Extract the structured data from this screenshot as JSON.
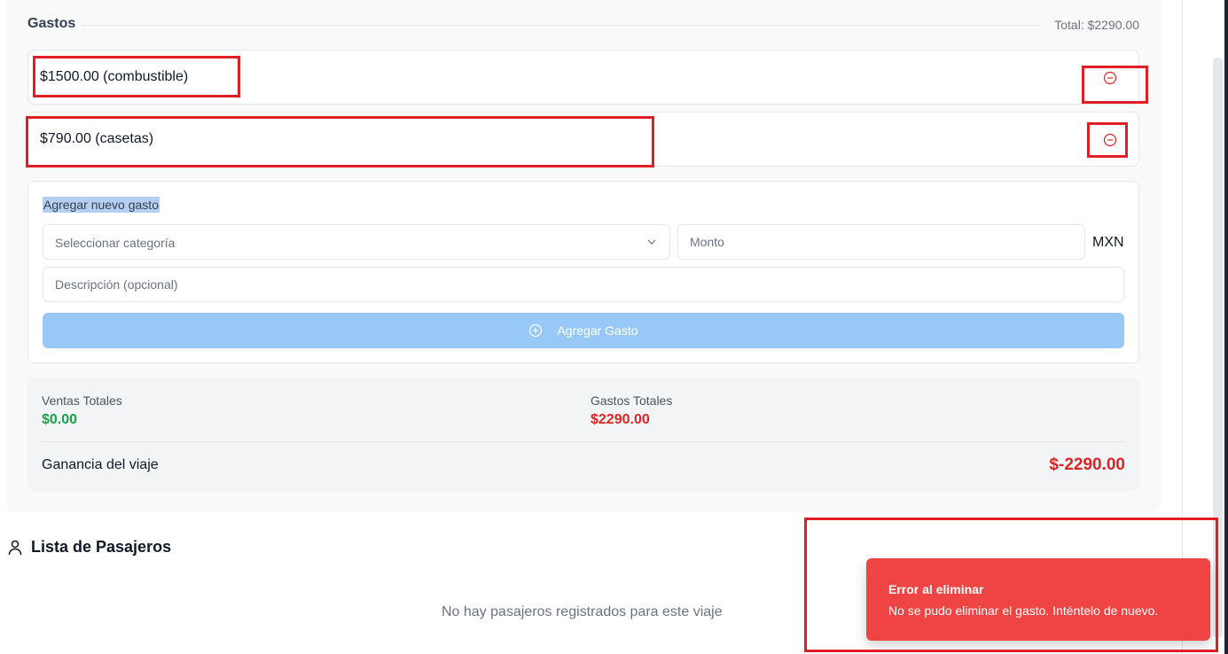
{
  "expenses": {
    "title": "Gastos",
    "total": "Total: $2290.00",
    "items": [
      {
        "label": "$1500.00 (combustible)",
        "remove_icon": "minus-circle-icon"
      },
      {
        "label": "$790.00 (casetas)",
        "remove_icon": "minus-circle-icon"
      }
    ]
  },
  "add_expense": {
    "title": "Agregar nuevo gasto",
    "category_placeholder": "Seleccionar categoría",
    "amount_placeholder": "Monto",
    "currency": "MXN",
    "description_placeholder": "Descripción (opcional)",
    "button_label": "Agregar Gasto",
    "button_icon": "plus-circle-icon"
  },
  "summary": {
    "sales_label": "Ventas Totales",
    "sales_value": "$0.00",
    "expenses_label": "Gastos Totales",
    "expenses_value": "$2290.00",
    "profit_label": "Ganancia del viaje",
    "profit_value": "$-2290.00"
  },
  "passengers": {
    "title": "Lista de Pasajeros",
    "icon": "user-icon",
    "empty_message": "No hay pasajeros registrados para este viaje"
  },
  "toast": {
    "title": "Error al eliminar",
    "message": "No se pudo eliminar el gasto. Inténtelo de nuevo."
  },
  "colors": {
    "highlight_box": "#e11d26",
    "success": "#16a34a",
    "danger": "#dc2626",
    "toast_bg": "#ef4444",
    "button_disabled": "#98c8f5"
  }
}
